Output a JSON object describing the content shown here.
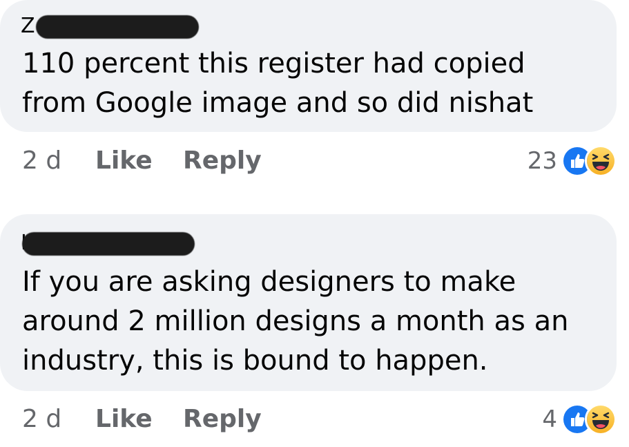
{
  "comments": [
    {
      "author_visible": "Ze",
      "text_lines": [
        "110 percent this register had copied",
        "from Google image and so did nishat"
      ],
      "time": "2 d",
      "like_label": "Like",
      "reply_label": "Reply",
      "reaction_count": "23",
      "reactions": [
        "like-icon",
        "haha-icon"
      ]
    },
    {
      "author_visible": "H",
      "text_lines": [
        "If you are asking designers to make",
        "around 2 million designs a month as an",
        "industry, this is bound to happen."
      ],
      "time": "2 d",
      "like_label": "Like",
      "reply_label": "Reply",
      "reaction_count": "4",
      "reactions": [
        "like-icon",
        "haha-icon"
      ]
    }
  ],
  "colors": {
    "bubble": "#f0f2f5",
    "meta_text": "#65676b",
    "like_blue": "#1877f2",
    "haha_yellow": "#f7b125"
  }
}
